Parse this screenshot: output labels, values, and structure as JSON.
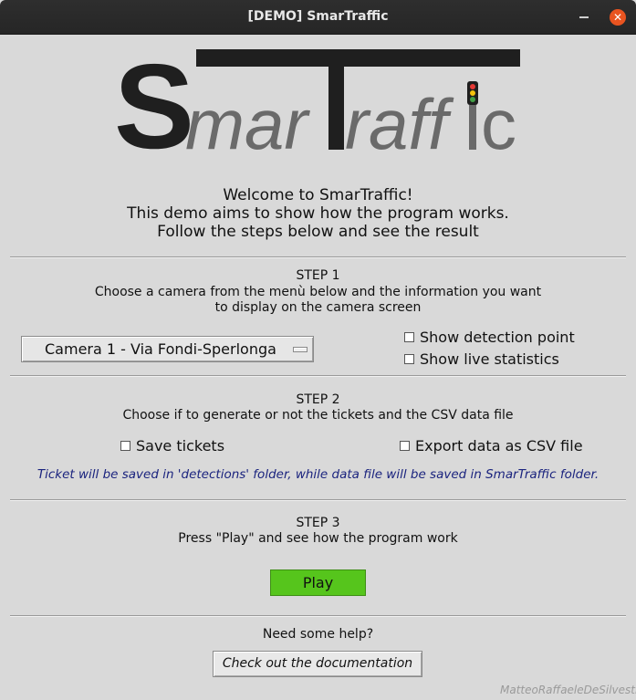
{
  "window": {
    "title": "[DEMO] SmarTraffic",
    "minimize_icon": "minimize-icon",
    "close_icon": "close-icon",
    "close_glyph": "✕"
  },
  "logo": {
    "text_S": "S",
    "text_mar": "mar",
    "text_T": "T",
    "text_raff": "raff",
    "text_c": "c",
    "icon": "traffic-light-icon",
    "colors": {
      "dark": "#1f1f1f",
      "light_text": "#6a6a6a",
      "red": "#e53935",
      "yellow": "#f4c20d",
      "green": "#43a047"
    }
  },
  "welcome": {
    "line1": "Welcome to SmarTraffic!",
    "line2": "This demo aims to show how the program works.",
    "line3": "Follow the steps below and see the result"
  },
  "step1": {
    "title": "STEP 1",
    "desc_line1": "Choose a camera from the menù below and the information you want",
    "desc_line2": "to display on the camera screen",
    "camera_select_value": "Camera 1 - Via Fondi-Sperlonga",
    "checkbox_detection": "Show detection point",
    "checkbox_statistics": "Show live statistics"
  },
  "step2": {
    "title": "STEP 2",
    "desc": "Choose if to generate or not the tickets and the CSV data file",
    "checkbox_tickets": "Save tickets",
    "checkbox_csv": "Export data as CSV file",
    "note": "Ticket will be saved in 'detections' folder, while data file will be saved in SmarTraffic folder."
  },
  "step3": {
    "title": "STEP 3",
    "desc": "Press \"Play\" and see how the program work",
    "play_label": "Play",
    "play_color": "#56c51c"
  },
  "help": {
    "question": "Need some help?",
    "docs_button": "Check out the documentation"
  },
  "signature": "MatteoRaffaeleDeSilvestri"
}
